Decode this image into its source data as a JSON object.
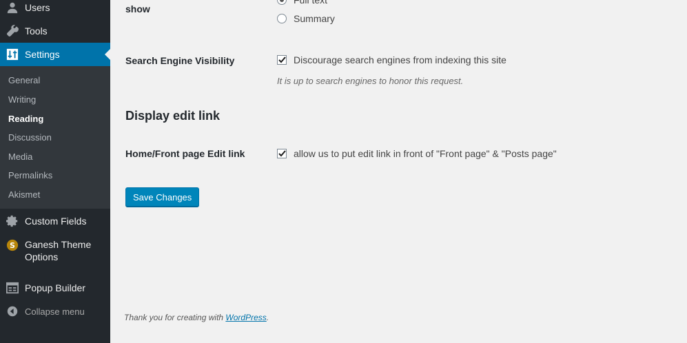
{
  "sidebar": {
    "menu": {
      "users": "Users",
      "tools": "Tools",
      "settings": "Settings",
      "custom_fields": "Custom Fields",
      "ganesh_line1": "Ganesh Theme",
      "ganesh_line2": "Options",
      "popup_builder": "Popup Builder",
      "collapse": "Collapse menu"
    },
    "submenu": {
      "general": "General",
      "writing": "Writing",
      "reading": "Reading",
      "discussion": "Discussion",
      "media": "Media",
      "permalinks": "Permalinks",
      "akismet": "Akismet"
    },
    "accent_color": "#0073aa",
    "bg_color": "#23282d"
  },
  "main": {
    "show_label": "show",
    "radio_full_text": "Full text",
    "radio_summary": "Summary",
    "sev_label": "Search Engine Visibility",
    "sev_checkbox_label": "Discourage search engines from indexing this site",
    "sev_checked": true,
    "sev_desc": "It is up to search engines to honor this request.",
    "section_title": "Display edit link",
    "edit_label": "Home/Front page Edit link",
    "edit_checkbox_label": "allow us to put edit link in front of \"Front page\" & \"Posts page\"",
    "edit_checked": true,
    "save_button": "Save Changes",
    "footer_text": "Thank you for creating with ",
    "footer_link": "WordPress",
    "footer_period": "."
  }
}
